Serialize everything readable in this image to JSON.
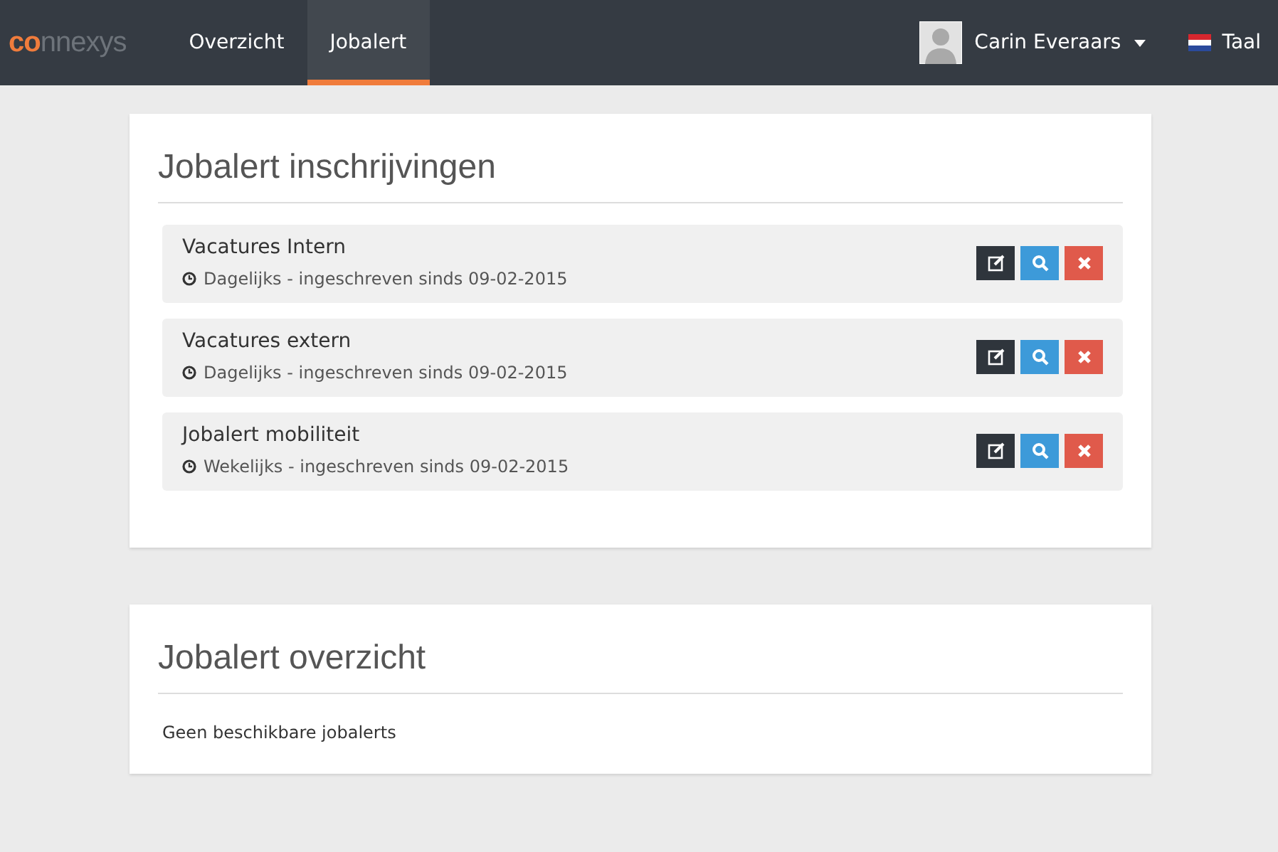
{
  "navbar": {
    "logo": {
      "accent": "co",
      "rest": "nnexys"
    },
    "tabs": [
      {
        "label": "Overzicht",
        "selected": false
      },
      {
        "label": "Jobalert",
        "selected": true
      }
    ],
    "user": {
      "name": "Carin Everaars"
    },
    "language": {
      "label": "Taal"
    }
  },
  "subscriptions": {
    "title": "Jobalert inschrijvingen",
    "items": [
      {
        "name": "Vacatures Intern",
        "detail": "Dagelijks - ingeschreven sinds 09-02-2015"
      },
      {
        "name": "Vacatures extern",
        "detail": "Dagelijks - ingeschreven sinds 09-02-2015"
      },
      {
        "name": "Jobalert mobiliteit",
        "detail": "Wekelijks - ingeschreven sinds 09-02-2015"
      }
    ]
  },
  "overview": {
    "title": "Jobalert overzicht",
    "empty_message": "Geen beschikbare jobalerts"
  }
}
